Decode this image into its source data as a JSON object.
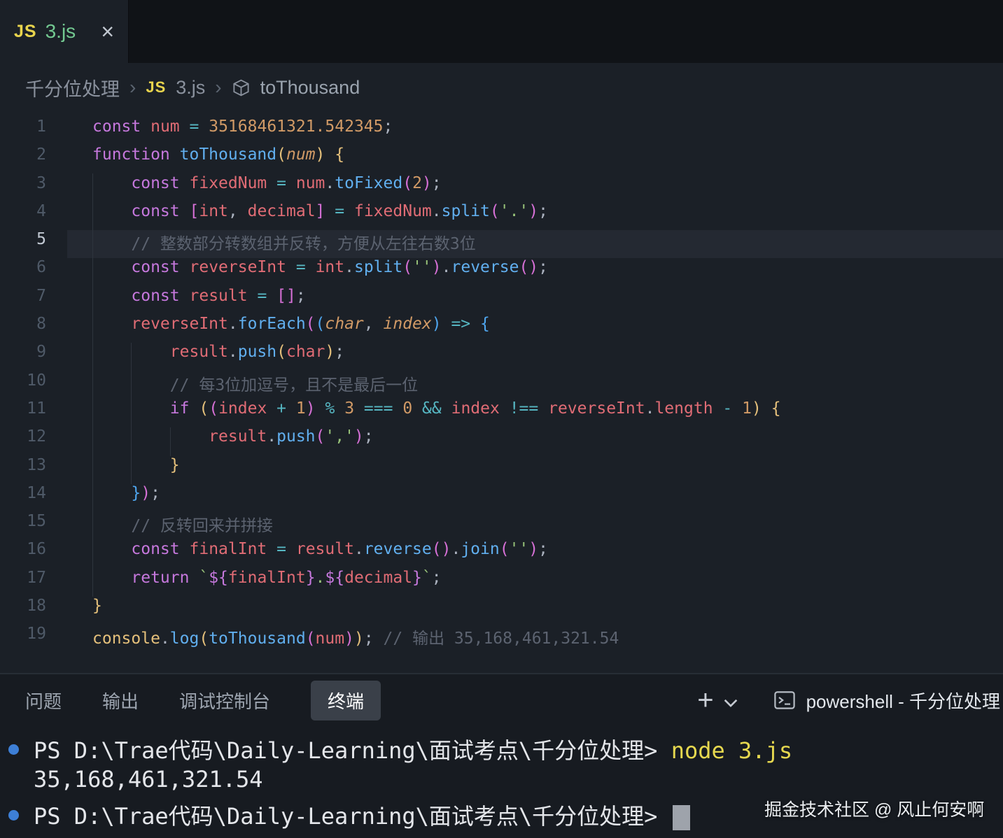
{
  "tab_bar": {
    "tab": {
      "icon": "JS",
      "label": "3.js",
      "close": "×"
    }
  },
  "breadcrumb": {
    "folder": "千分位处理",
    "separator": "›",
    "file_icon": "JS",
    "file": "3.js",
    "symbol_icon": "symbol-method-cube",
    "symbol": "toThousand"
  },
  "editor": {
    "active_line": 5,
    "lines": [
      {
        "n": 1,
        "tokens": [
          {
            "t": "const",
            "c": "kw"
          },
          {
            "t": " "
          },
          {
            "t": "num",
            "c": "var"
          },
          {
            "t": " "
          },
          {
            "t": "=",
            "c": "op"
          },
          {
            "t": " "
          },
          {
            "t": "35168461321.542345",
            "c": "num"
          },
          {
            "t": ";"
          }
        ]
      },
      {
        "n": 2,
        "tokens": [
          {
            "t": "function",
            "c": "kw"
          },
          {
            "t": " "
          },
          {
            "t": "toThousand",
            "c": "fn"
          },
          {
            "t": "(",
            "c": "b1"
          },
          {
            "t": "num",
            "c": "param"
          },
          {
            "t": ")",
            "c": "b1"
          },
          {
            "t": " "
          },
          {
            "t": "{",
            "c": "b1"
          }
        ]
      },
      {
        "n": 3,
        "tokens": [
          {
            "t": "    "
          },
          {
            "t": "const",
            "c": "kw"
          },
          {
            "t": " "
          },
          {
            "t": "fixedNum",
            "c": "var"
          },
          {
            "t": " "
          },
          {
            "t": "=",
            "c": "op"
          },
          {
            "t": " "
          },
          {
            "t": "num",
            "c": "var"
          },
          {
            "t": "."
          },
          {
            "t": "toFixed",
            "c": "fn"
          },
          {
            "t": "(",
            "c": "b2"
          },
          {
            "t": "2",
            "c": "num"
          },
          {
            "t": ")",
            "c": "b2"
          },
          {
            "t": ";"
          }
        ]
      },
      {
        "n": 4,
        "tokens": [
          {
            "t": "    "
          },
          {
            "t": "const",
            "c": "kw"
          },
          {
            "t": " "
          },
          {
            "t": "[",
            "c": "b2"
          },
          {
            "t": "int",
            "c": "var"
          },
          {
            "t": ", "
          },
          {
            "t": "decimal",
            "c": "var"
          },
          {
            "t": "]",
            "c": "b2"
          },
          {
            "t": " "
          },
          {
            "t": "=",
            "c": "op"
          },
          {
            "t": " "
          },
          {
            "t": "fixedNum",
            "c": "var"
          },
          {
            "t": "."
          },
          {
            "t": "split",
            "c": "fn"
          },
          {
            "t": "(",
            "c": "b2"
          },
          {
            "t": "'.'",
            "c": "str"
          },
          {
            "t": ")",
            "c": "b2"
          },
          {
            "t": ";"
          }
        ]
      },
      {
        "n": 5,
        "tokens": [
          {
            "t": "    "
          },
          {
            "t": "// 整数部分转数组并反转，方便从左往右数3位",
            "c": "cm"
          }
        ]
      },
      {
        "n": 6,
        "tokens": [
          {
            "t": "    "
          },
          {
            "t": "const",
            "c": "kw"
          },
          {
            "t": " "
          },
          {
            "t": "reverseInt",
            "c": "var"
          },
          {
            "t": " "
          },
          {
            "t": "=",
            "c": "op"
          },
          {
            "t": " "
          },
          {
            "t": "int",
            "c": "var"
          },
          {
            "t": "."
          },
          {
            "t": "split",
            "c": "fn"
          },
          {
            "t": "(",
            "c": "b2"
          },
          {
            "t": "''",
            "c": "str"
          },
          {
            "t": ")",
            "c": "b2"
          },
          {
            "t": "."
          },
          {
            "t": "reverse",
            "c": "fn"
          },
          {
            "t": "(",
            "c": "b2"
          },
          {
            "t": ")",
            "c": "b2"
          },
          {
            "t": ";"
          }
        ]
      },
      {
        "n": 7,
        "tokens": [
          {
            "t": "    "
          },
          {
            "t": "const",
            "c": "kw"
          },
          {
            "t": " "
          },
          {
            "t": "result",
            "c": "var"
          },
          {
            "t": " "
          },
          {
            "t": "=",
            "c": "op"
          },
          {
            "t": " "
          },
          {
            "t": "[]",
            "c": "b2"
          },
          {
            "t": ";"
          }
        ]
      },
      {
        "n": 8,
        "tokens": [
          {
            "t": "    "
          },
          {
            "t": "reverseInt",
            "c": "var"
          },
          {
            "t": "."
          },
          {
            "t": "forEach",
            "c": "fn"
          },
          {
            "t": "(",
            "c": "b2"
          },
          {
            "t": "(",
            "c": "b3"
          },
          {
            "t": "char",
            "c": "param"
          },
          {
            "t": ", "
          },
          {
            "t": "index",
            "c": "param"
          },
          {
            "t": ")",
            "c": "b3"
          },
          {
            "t": " "
          },
          {
            "t": "=>",
            "c": "op"
          },
          {
            "t": " "
          },
          {
            "t": "{",
            "c": "b3"
          }
        ]
      },
      {
        "n": 9,
        "tokens": [
          {
            "t": "        "
          },
          {
            "t": "result",
            "c": "var"
          },
          {
            "t": "."
          },
          {
            "t": "push",
            "c": "fn"
          },
          {
            "t": "(",
            "c": "b1"
          },
          {
            "t": "char",
            "c": "var"
          },
          {
            "t": ")",
            "c": "b1"
          },
          {
            "t": ";"
          }
        ]
      },
      {
        "n": 10,
        "tokens": [
          {
            "t": "        "
          },
          {
            "t": "// 每3位加逗号，且不是最后一位",
            "c": "cm"
          }
        ]
      },
      {
        "n": 11,
        "tokens": [
          {
            "t": "        "
          },
          {
            "t": "if",
            "c": "kw"
          },
          {
            "t": " "
          },
          {
            "t": "(",
            "c": "b1"
          },
          {
            "t": "(",
            "c": "b2"
          },
          {
            "t": "index",
            "c": "var"
          },
          {
            "t": " "
          },
          {
            "t": "+",
            "c": "op"
          },
          {
            "t": " "
          },
          {
            "t": "1",
            "c": "num"
          },
          {
            "t": ")",
            "c": "b2"
          },
          {
            "t": " "
          },
          {
            "t": "%",
            "c": "op"
          },
          {
            "t": " "
          },
          {
            "t": "3",
            "c": "num"
          },
          {
            "t": " "
          },
          {
            "t": "===",
            "c": "op"
          },
          {
            "t": " "
          },
          {
            "t": "0",
            "c": "num"
          },
          {
            "t": " "
          },
          {
            "t": "&&",
            "c": "op"
          },
          {
            "t": " "
          },
          {
            "t": "index",
            "c": "var"
          },
          {
            "t": " "
          },
          {
            "t": "!==",
            "c": "op"
          },
          {
            "t": " "
          },
          {
            "t": "reverseInt",
            "c": "var"
          },
          {
            "t": "."
          },
          {
            "t": "length",
            "c": "var"
          },
          {
            "t": " "
          },
          {
            "t": "-",
            "c": "op"
          },
          {
            "t": " "
          },
          {
            "t": "1",
            "c": "num"
          },
          {
            "t": ")",
            "c": "b1"
          },
          {
            "t": " "
          },
          {
            "t": "{",
            "c": "b1"
          }
        ]
      },
      {
        "n": 12,
        "tokens": [
          {
            "t": "            "
          },
          {
            "t": "result",
            "c": "var"
          },
          {
            "t": "."
          },
          {
            "t": "push",
            "c": "fn"
          },
          {
            "t": "(",
            "c": "b2"
          },
          {
            "t": "','",
            "c": "str"
          },
          {
            "t": ")",
            "c": "b2"
          },
          {
            "t": ";"
          }
        ]
      },
      {
        "n": 13,
        "tokens": [
          {
            "t": "        "
          },
          {
            "t": "}",
            "c": "b1"
          }
        ]
      },
      {
        "n": 14,
        "tokens": [
          {
            "t": "    "
          },
          {
            "t": "}",
            "c": "b3"
          },
          {
            "t": ")",
            "c": "b2"
          },
          {
            "t": ";"
          }
        ]
      },
      {
        "n": 15,
        "tokens": [
          {
            "t": "    "
          },
          {
            "t": "// 反转回来并拼接",
            "c": "cm"
          }
        ]
      },
      {
        "n": 16,
        "tokens": [
          {
            "t": "    "
          },
          {
            "t": "const",
            "c": "kw"
          },
          {
            "t": " "
          },
          {
            "t": "finalInt",
            "c": "var"
          },
          {
            "t": " "
          },
          {
            "t": "=",
            "c": "op"
          },
          {
            "t": " "
          },
          {
            "t": "result",
            "c": "var"
          },
          {
            "t": "."
          },
          {
            "t": "reverse",
            "c": "fn"
          },
          {
            "t": "(",
            "c": "b2"
          },
          {
            "t": ")",
            "c": "b2"
          },
          {
            "t": "."
          },
          {
            "t": "join",
            "c": "fn"
          },
          {
            "t": "(",
            "c": "b2"
          },
          {
            "t": "''",
            "c": "str"
          },
          {
            "t": ")",
            "c": "b2"
          },
          {
            "t": ";"
          }
        ]
      },
      {
        "n": 17,
        "tokens": [
          {
            "t": "    "
          },
          {
            "t": "return",
            "c": "kw"
          },
          {
            "t": " "
          },
          {
            "t": "`",
            "c": "str"
          },
          {
            "t": "${",
            "c": "kw"
          },
          {
            "t": "finalInt",
            "c": "var"
          },
          {
            "t": "}",
            "c": "kw"
          },
          {
            "t": ".",
            "c": "str"
          },
          {
            "t": "${",
            "c": "kw"
          },
          {
            "t": "decimal",
            "c": "var"
          },
          {
            "t": "}",
            "c": "kw"
          },
          {
            "t": "`",
            "c": "str"
          },
          {
            "t": ";"
          }
        ]
      },
      {
        "n": 18,
        "tokens": [
          {
            "t": "}",
            "c": "b1"
          }
        ]
      },
      {
        "n": 19,
        "tokens": [
          {
            "t": "console",
            "c": "cls"
          },
          {
            "t": "."
          },
          {
            "t": "log",
            "c": "fn"
          },
          {
            "t": "(",
            "c": "b1"
          },
          {
            "t": "toThousand",
            "c": "fn"
          },
          {
            "t": "(",
            "c": "b2"
          },
          {
            "t": "num",
            "c": "var"
          },
          {
            "t": ")",
            "c": "b2"
          },
          {
            "t": ")",
            "c": "b1"
          },
          {
            "t": ";"
          },
          {
            "t": " "
          },
          {
            "t": "// 输出 35,168,461,321.54",
            "c": "cm"
          }
        ]
      }
    ]
  },
  "panel": {
    "tabs": [
      {
        "name": "problems",
        "label": "问题",
        "active": false
      },
      {
        "name": "output",
        "label": "输出",
        "active": false
      },
      {
        "name": "debug-console",
        "label": "调试控制台",
        "active": false
      },
      {
        "name": "terminal",
        "label": "终端",
        "active": true
      }
    ],
    "new_terminal_label": "+",
    "dropdown_icon": "chevron-down",
    "terminal_icon": "terminal",
    "session_label": "powershell - 千分位处理"
  },
  "terminal": {
    "lines": [
      {
        "dot": true,
        "cursor": false,
        "segments": [
          {
            "t": "PS D:\\Trae代码\\Daily-Learning\\面试考点\\千分位处理> ",
            "c": "plain"
          },
          {
            "t": "node 3.js",
            "c": "cmd"
          }
        ]
      },
      {
        "dot": false,
        "cursor": false,
        "segments": [
          {
            "t": "35,168,461,321.54",
            "c": "plain"
          }
        ]
      },
      {
        "dot": true,
        "cursor": true,
        "segments": [
          {
            "t": "PS D:\\Trae代码\\Daily-Learning\\面试考点\\千分位处理> ",
            "c": "plain"
          }
        ]
      }
    ]
  },
  "watermark": "掘金技术社区 @ 风止何安啊",
  "colors": {
    "background": "#1b2027",
    "tab_strip": "#101317",
    "panel_background": "#171b21",
    "line_highlight": "#242932",
    "keyword": "#c678dd",
    "variable": "#e06c75",
    "function": "#61afef",
    "number": "#d19a66",
    "string": "#98c379",
    "comment": "#5c6370",
    "operator": "#56b6c2",
    "punctuation": "#abb2bf",
    "bracket_gold": "#e5c07b",
    "bracket_purple": "#d670d6",
    "bracket_blue": "#4fa6ef",
    "class_name": "#e5c07b",
    "untracked_file": "#73c991",
    "command_decoration": "#3d7fd6",
    "terminal_command": "#e6d84f"
  }
}
